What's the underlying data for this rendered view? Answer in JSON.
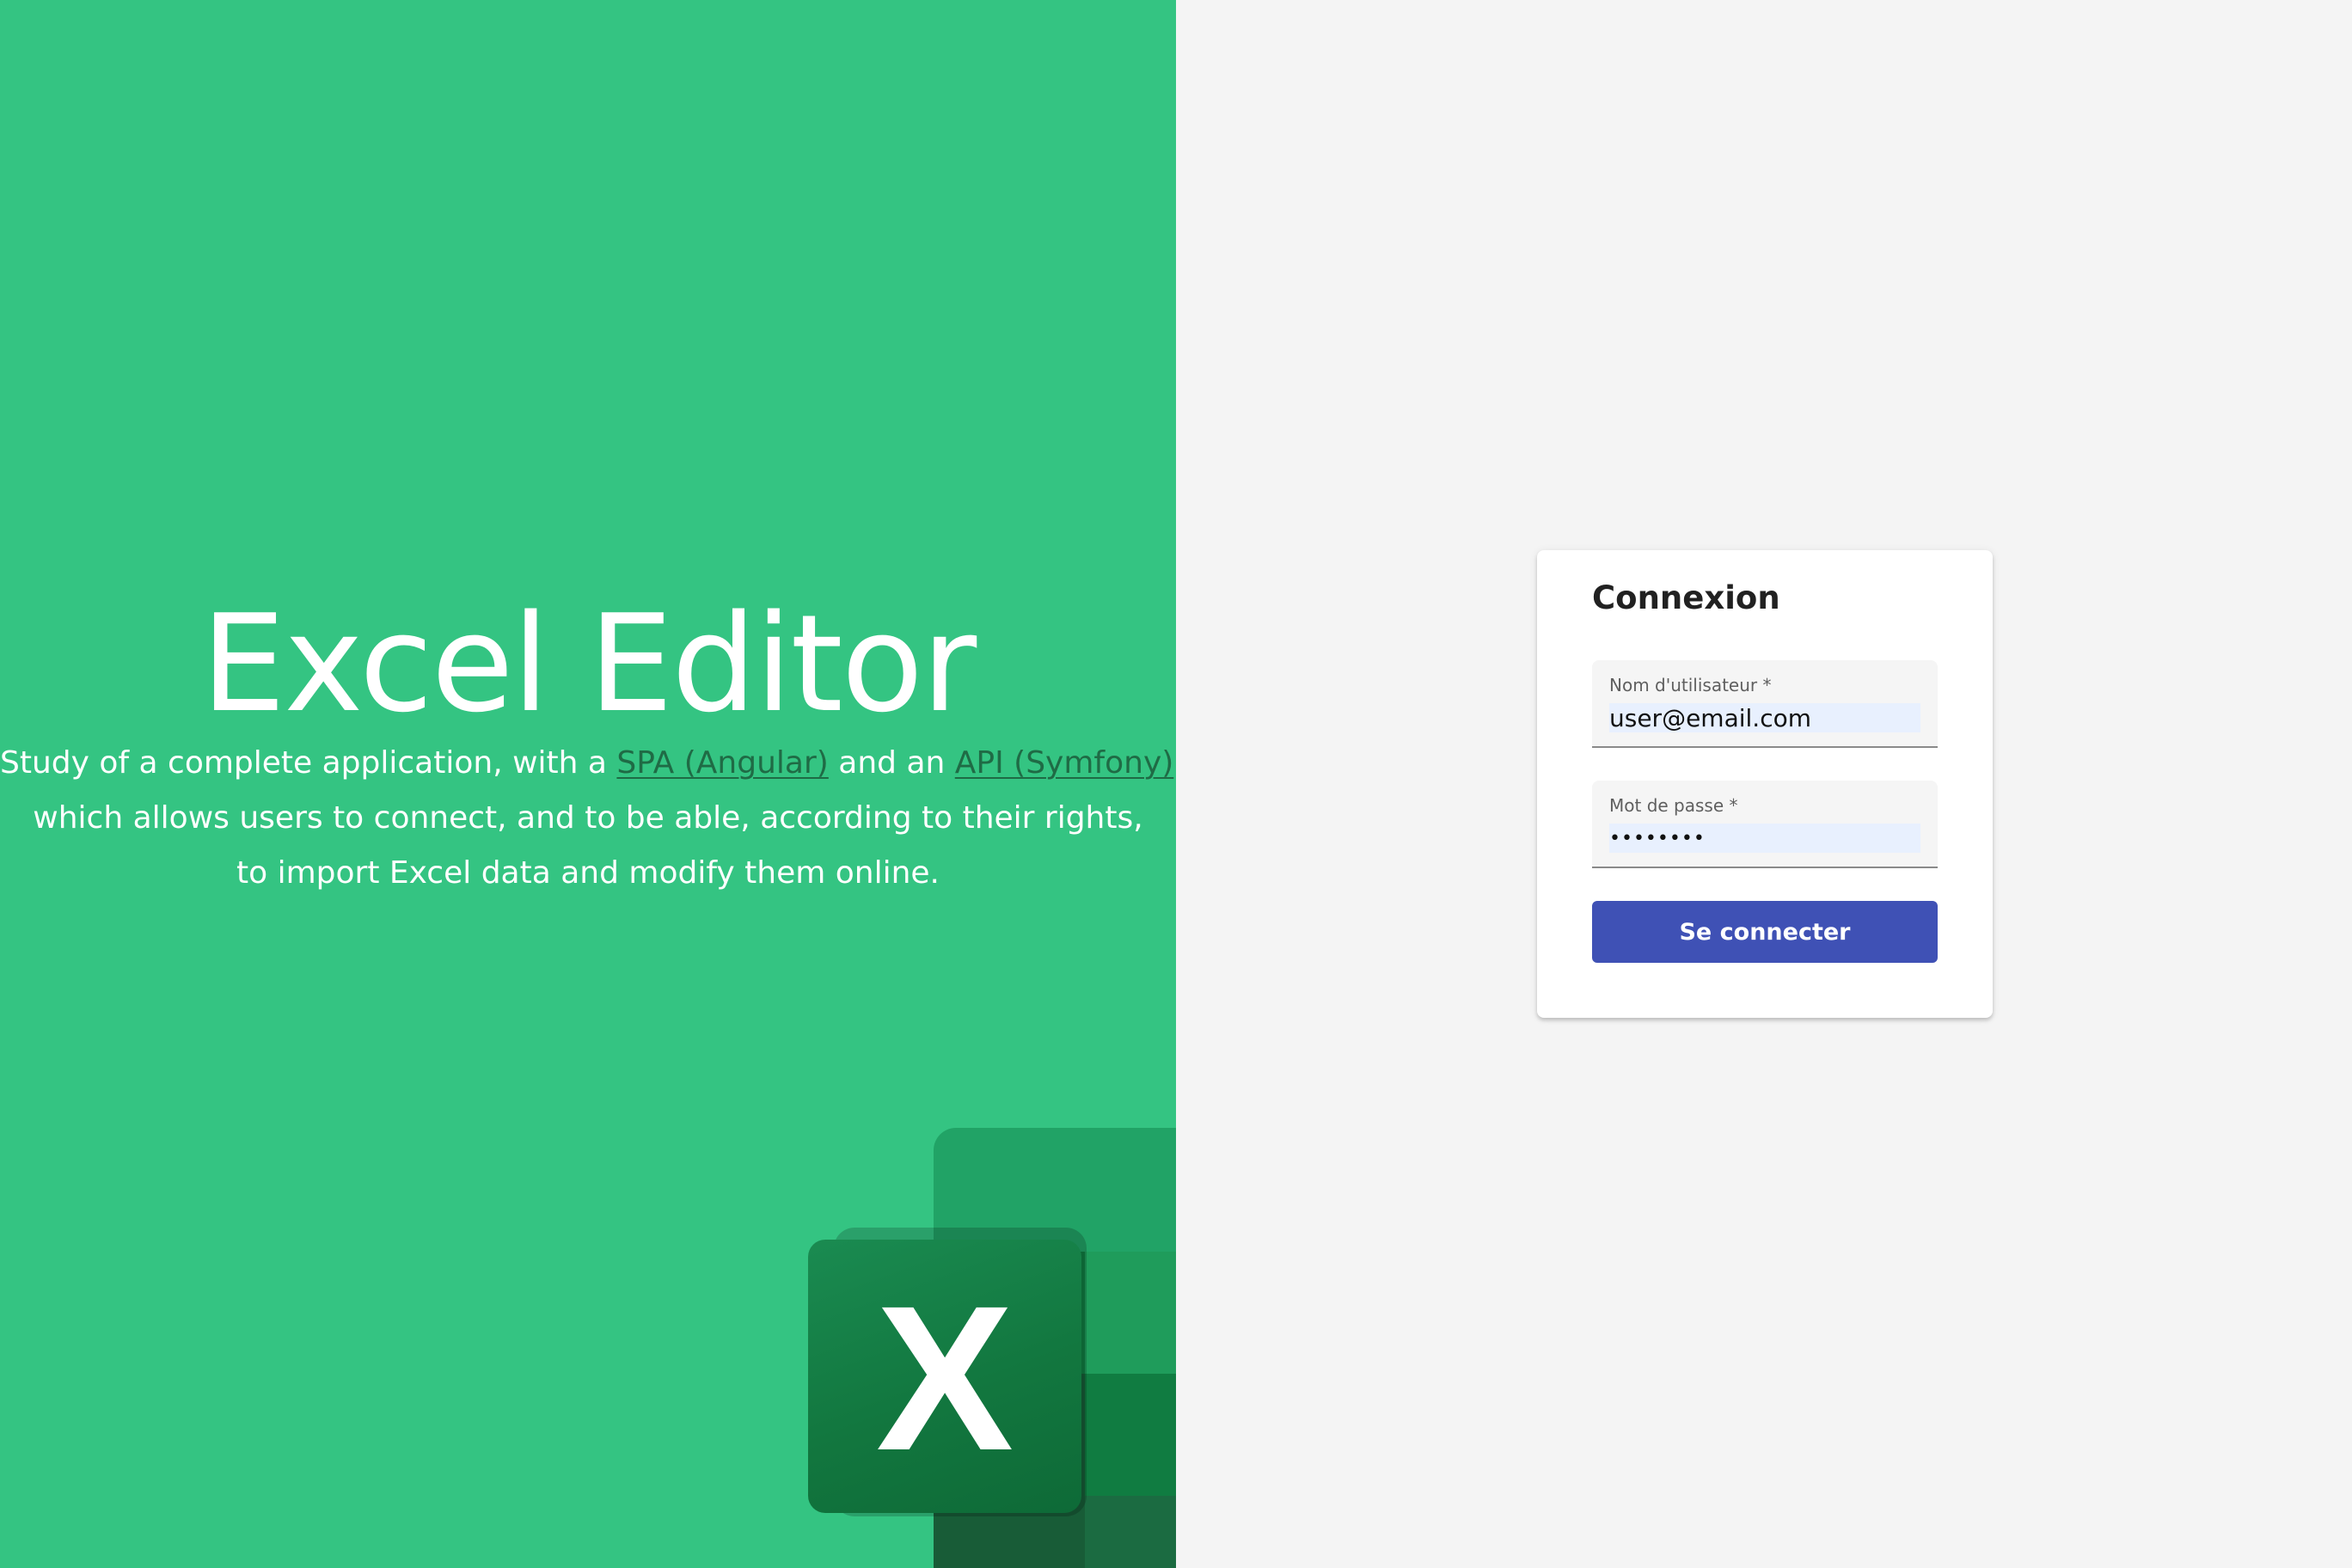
{
  "hero": {
    "title": "Excel Editor",
    "line1_pre": "Study of a complete application, with a ",
    "spa_link": "SPA (Angular)",
    "line1_mid": " and an ",
    "api_link": "API (Symfony)",
    "line1_post": ",",
    "line2": "which allows users to connect, and to be able, according to their rights,",
    "line3": "to import Excel data and modify them online."
  },
  "logo": {
    "letter": "X",
    "colors": {
      "sheet_top": "#21a366",
      "sheet_mid": "#107c41",
      "sheet_mid_right": "#33c481",
      "sheet_bottom": "#185c37",
      "tile": "#107c41",
      "background": "#34c482"
    }
  },
  "login": {
    "title": "Connexion",
    "username_label": "Nom d'utilisateur *",
    "username_value": "user@email.com",
    "password_label": "Mot de passe *",
    "password_value": "••••••••",
    "submit_label": "Se connecter"
  },
  "colors": {
    "left_background": "#34c482",
    "right_background": "#f4f4f4",
    "button": "#3f51b5",
    "link": "#1f6b45"
  }
}
